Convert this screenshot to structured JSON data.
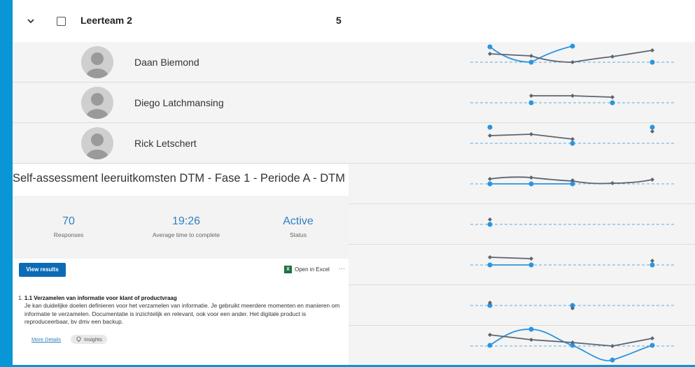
{
  "team": {
    "name": "Leerteam 2",
    "count": "5"
  },
  "members": [
    {
      "name": "Daan Biemond"
    },
    {
      "name": "Diego Latchmansing"
    },
    {
      "name": "Rick Letschert"
    }
  ],
  "form": {
    "title": "Self-assessment leeruitkomsten DTM - Fase 1 - Periode A - DTM",
    "stats": [
      {
        "value": "70",
        "label": "Responses"
      },
      {
        "value": "19:26",
        "label": "Average time to complete"
      },
      {
        "value": "Active",
        "label": "Status"
      }
    ],
    "view_results": "View results",
    "open_excel": "Open in Excel",
    "more": "···",
    "question": {
      "number": "1.",
      "title": "1.1 Verzamelen van informatie voor klant of productvraag",
      "description": "Je kan duidelijke doelen definieren voor het verzamelen van informatie. Je gebruikt meerdere momenten en manieren om informatie te verzamelen. Documentatie is inzichtelijk en relevant, ook voor een ander. Het digitale product is reproduceerbaar, bv dmv een backup.",
      "more_details": "More Details",
      "insights": "Insights"
    }
  },
  "colors": {
    "accent_blue": "#2b95e0",
    "dark_line": "#5c6570",
    "frame": "#0a95d6"
  }
}
